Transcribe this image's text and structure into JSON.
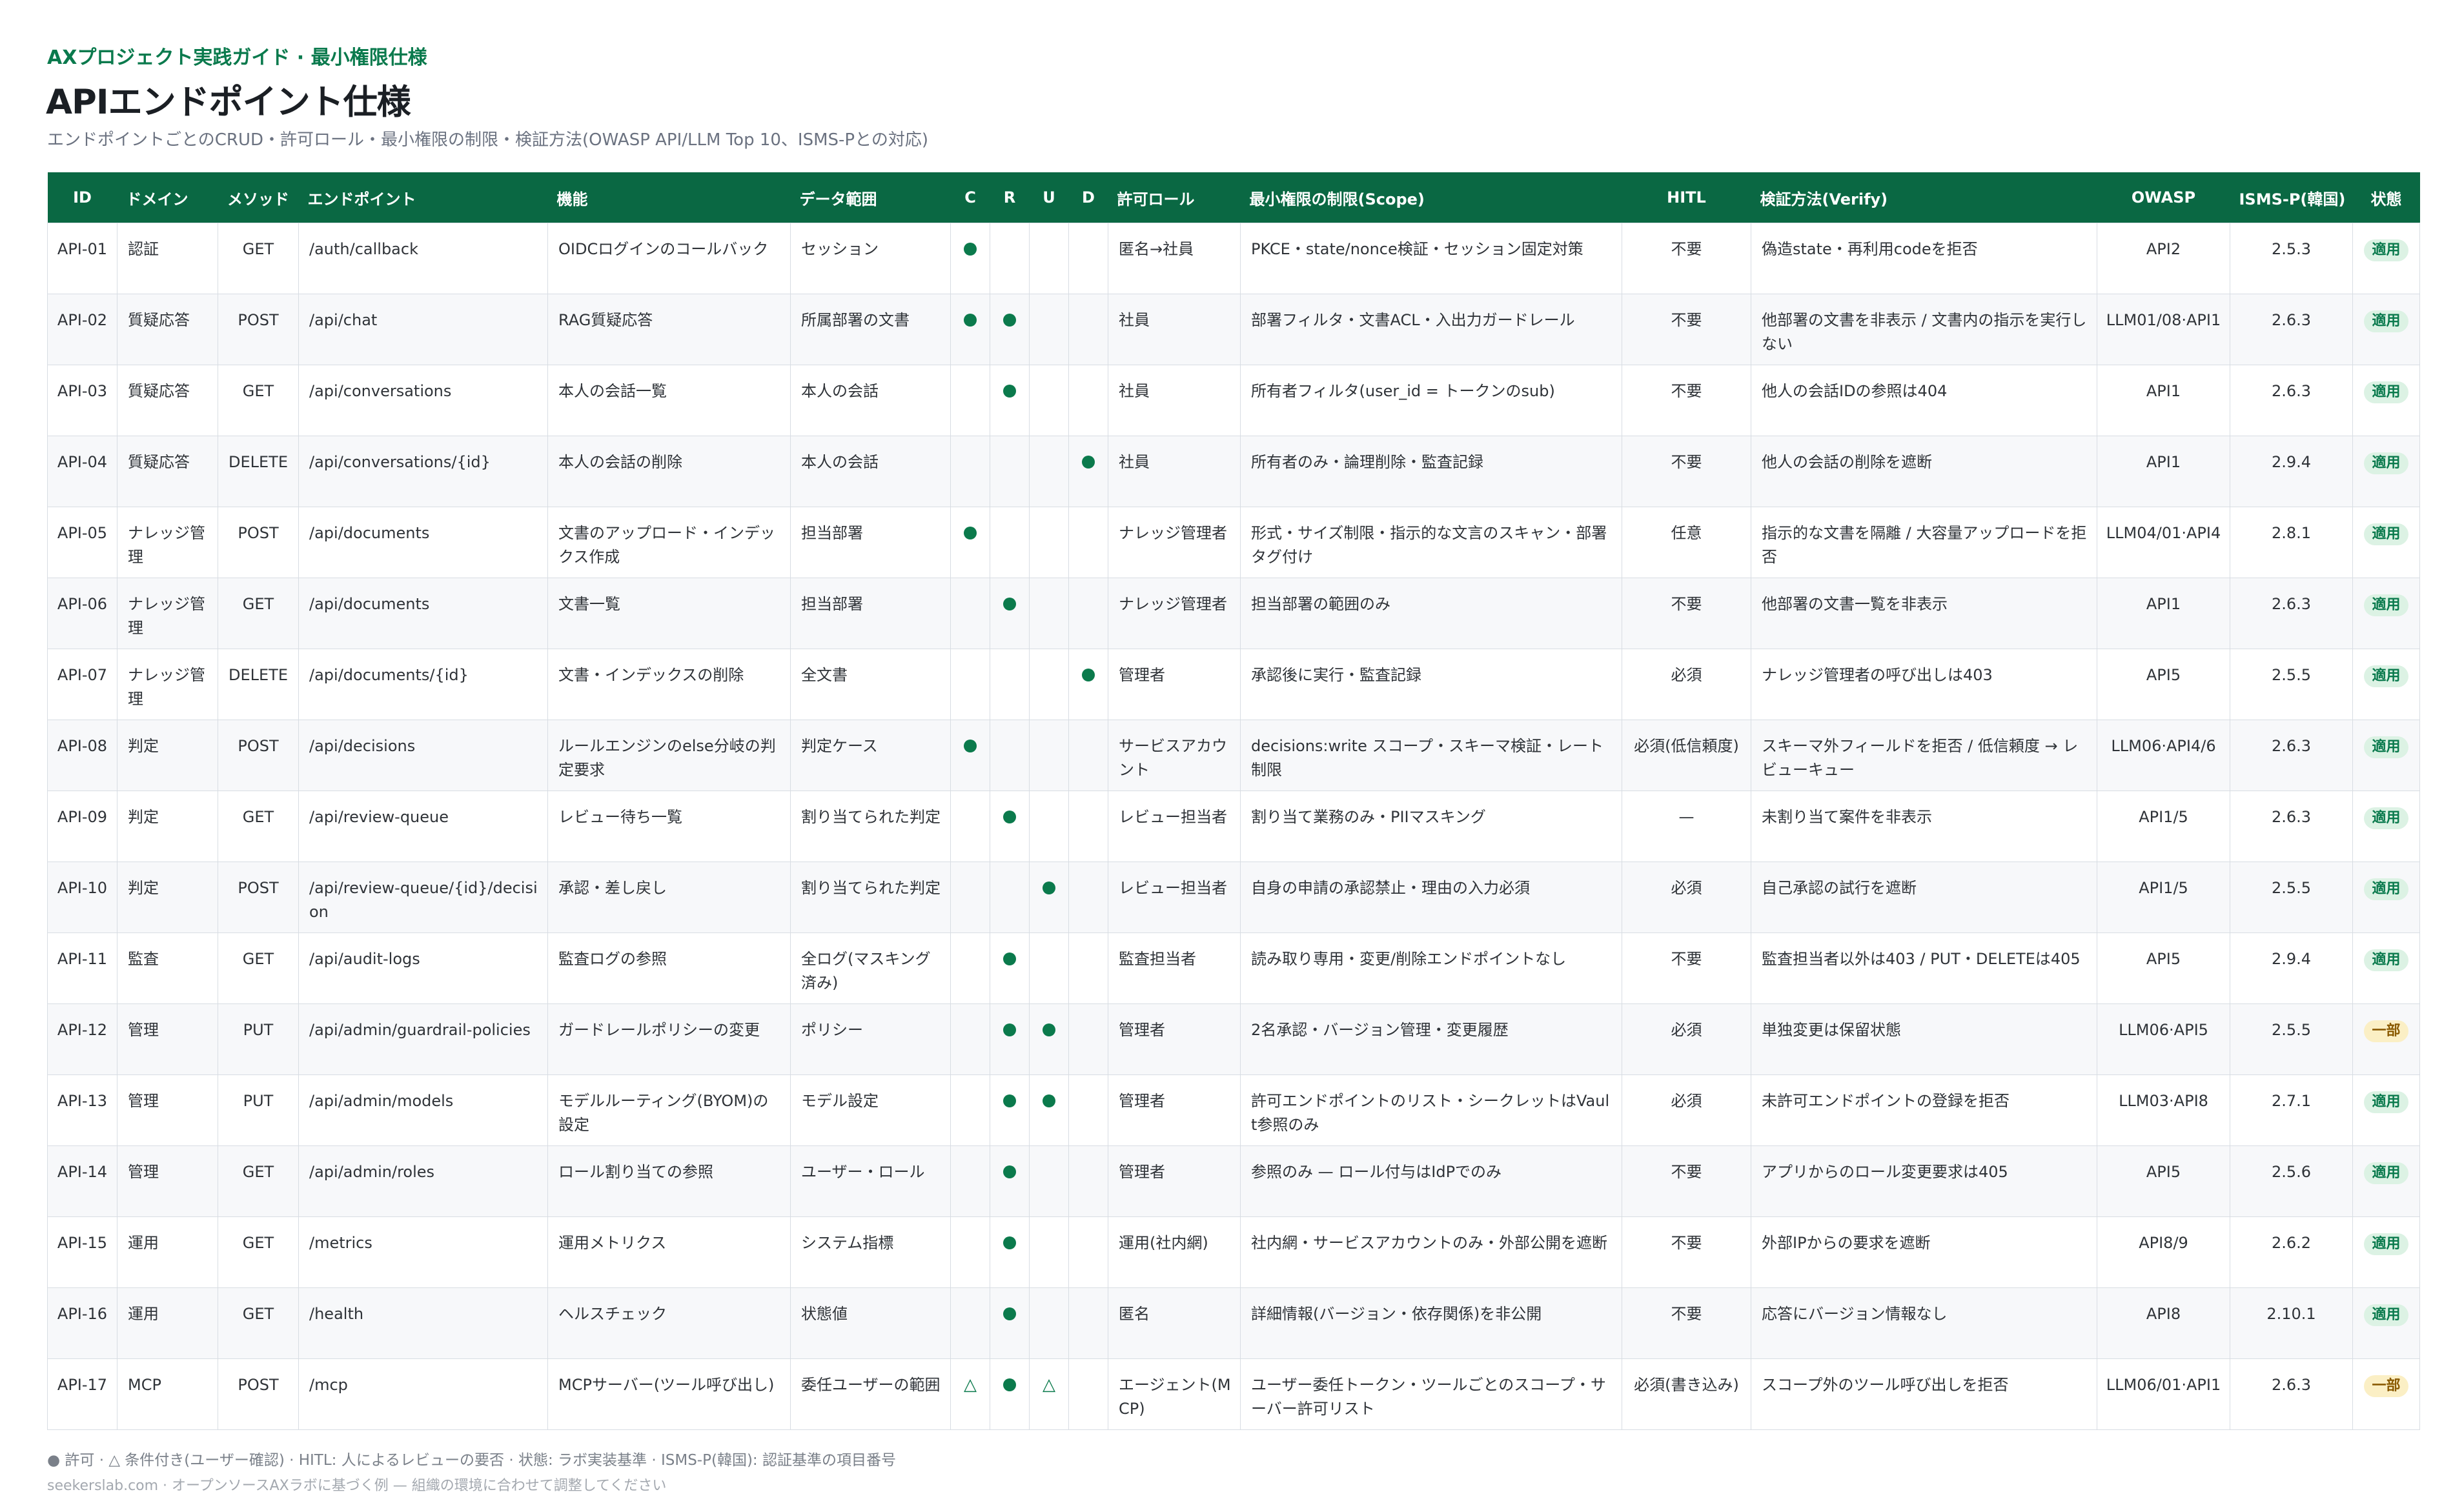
{
  "header": {
    "kicker": "AXプロジェクト実践ガイド · 最小権限仕様",
    "title": "APIエンドポイント仕様",
    "subtitle": "エンドポイントごとのCRUD・許可ロール・最小権限の制限・検証方法(OWASP API/LLM Top 10、ISMS-Pとの対応)"
  },
  "table": {
    "columns": {
      "id": "ID",
      "domain": "ドメイン",
      "method": "メソッド",
      "endpoint": "エンドポイント",
      "function": "機能",
      "data_scope": "データ範囲",
      "c": "C",
      "r": "R",
      "u": "U",
      "d": "D",
      "role": "許可ロール",
      "scope": "最小権限の制限(Scope)",
      "hitl": "HITL",
      "verify": "検証方法(Verify)",
      "owasp": "OWASP",
      "isms": "ISMS-P(韓国)",
      "status": "状態"
    },
    "rows": [
      {
        "id": "API-01",
        "domain": "認証",
        "method": "GET",
        "endpoint": "/auth/callback",
        "function": "OIDCログインのコールバック",
        "data_scope": "セッション",
        "c": "●",
        "r": "",
        "u": "",
        "d": "",
        "role": "匿名→社員",
        "scope": "PKCE・state/nonce検証・セッション固定対策",
        "hitl": "不要",
        "verify": "偽造state・再利用codeを拒否",
        "owasp": "API2",
        "isms": "2.5.3",
        "status": "適用",
        "status_type": "ok"
      },
      {
        "id": "API-02",
        "domain": "質疑応答",
        "method": "POST",
        "endpoint": "/api/chat",
        "function": "RAG質疑応答",
        "data_scope": "所属部署の文書",
        "c": "●",
        "r": "●",
        "u": "",
        "d": "",
        "role": "社員",
        "scope": "部署フィルタ・文書ACL・入出力ガードレール",
        "hitl": "不要",
        "verify": "他部署の文書を非表示 / 文書内の指示を実行しない",
        "owasp": "LLM01/08·API1",
        "isms": "2.6.3",
        "status": "適用",
        "status_type": "ok"
      },
      {
        "id": "API-03",
        "domain": "質疑応答",
        "method": "GET",
        "endpoint": "/api/conversations",
        "function": "本人の会話一覧",
        "data_scope": "本人の会話",
        "c": "",
        "r": "●",
        "u": "",
        "d": "",
        "role": "社員",
        "scope": "所有者フィルタ(user_id = トークンのsub)",
        "hitl": "不要",
        "verify": "他人の会話IDの参照は404",
        "owasp": "API1",
        "isms": "2.6.3",
        "status": "適用",
        "status_type": "ok"
      },
      {
        "id": "API-04",
        "domain": "質疑応答",
        "method": "DELETE",
        "endpoint": "/api/conversations/{id}",
        "function": "本人の会話の削除",
        "data_scope": "本人の会話",
        "c": "",
        "r": "",
        "u": "",
        "d": "●",
        "role": "社員",
        "scope": "所有者のみ・論理削除・監査記録",
        "hitl": "不要",
        "verify": "他人の会話の削除を遮断",
        "owasp": "API1",
        "isms": "2.9.4",
        "status": "適用",
        "status_type": "ok"
      },
      {
        "id": "API-05",
        "domain": "ナレッジ管理",
        "method": "POST",
        "endpoint": "/api/documents",
        "function": "文書のアップロード・インデックス作成",
        "data_scope": "担当部署",
        "c": "●",
        "r": "",
        "u": "",
        "d": "",
        "role": "ナレッジ管理者",
        "scope": "形式・サイズ制限・指示的な文言のスキャン・部署タグ付け",
        "hitl": "任意",
        "verify": "指示的な文書を隔離 / 大容量アップロードを拒否",
        "owasp": "LLM04/01·API4",
        "isms": "2.8.1",
        "status": "適用",
        "status_type": "ok"
      },
      {
        "id": "API-06",
        "domain": "ナレッジ管理",
        "method": "GET",
        "endpoint": "/api/documents",
        "function": "文書一覧",
        "data_scope": "担当部署",
        "c": "",
        "r": "●",
        "u": "",
        "d": "",
        "role": "ナレッジ管理者",
        "scope": "担当部署の範囲のみ",
        "hitl": "不要",
        "verify": "他部署の文書一覧を非表示",
        "owasp": "API1",
        "isms": "2.6.3",
        "status": "適用",
        "status_type": "ok"
      },
      {
        "id": "API-07",
        "domain": "ナレッジ管理",
        "method": "DELETE",
        "endpoint": "/api/documents/{id}",
        "function": "文書・インデックスの削除",
        "data_scope": "全文書",
        "c": "",
        "r": "",
        "u": "",
        "d": "●",
        "role": "管理者",
        "scope": "承認後に実行・監査記録",
        "hitl": "必須",
        "verify": "ナレッジ管理者の呼び出しは403",
        "owasp": "API5",
        "isms": "2.5.5",
        "status": "適用",
        "status_type": "ok"
      },
      {
        "id": "API-08",
        "domain": "判定",
        "method": "POST",
        "endpoint": "/api/decisions",
        "function": "ルールエンジンのelse分岐の判定要求",
        "data_scope": "判定ケース",
        "c": "●",
        "r": "",
        "u": "",
        "d": "",
        "role": "サービスアカウント",
        "scope": "decisions:write スコープ・スキーマ検証・レート制限",
        "hitl": "必須(低信頼度)",
        "verify": "スキーマ外フィールドを拒否 / 低信頼度 → レビューキュー",
        "owasp": "LLM06·API4/6",
        "isms": "2.6.3",
        "status": "適用",
        "status_type": "ok"
      },
      {
        "id": "API-09",
        "domain": "判定",
        "method": "GET",
        "endpoint": "/api/review-queue",
        "function": "レビュー待ち一覧",
        "data_scope": "割り当てられた判定",
        "c": "",
        "r": "●",
        "u": "",
        "d": "",
        "role": "レビュー担当者",
        "scope": "割り当て業務のみ・PIIマスキング",
        "hitl": "—",
        "verify": "未割り当て案件を非表示",
        "owasp": "API1/5",
        "isms": "2.6.3",
        "status": "適用",
        "status_type": "ok"
      },
      {
        "id": "API-10",
        "domain": "判定",
        "method": "POST",
        "endpoint": "/api/review-queue/{id}/decision",
        "function": "承認・差し戻し",
        "data_scope": "割り当てられた判定",
        "c": "",
        "r": "",
        "u": "●",
        "d": "",
        "role": "レビュー担当者",
        "scope": "自身の申請の承認禁止・理由の入力必須",
        "hitl": "必須",
        "verify": "自己承認の試行を遮断",
        "owasp": "API1/5",
        "isms": "2.5.5",
        "status": "適用",
        "status_type": "ok"
      },
      {
        "id": "API-11",
        "domain": "監査",
        "method": "GET",
        "endpoint": "/api/audit-logs",
        "function": "監査ログの参照",
        "data_scope": "全ログ(マスキング済み)",
        "c": "",
        "r": "●",
        "u": "",
        "d": "",
        "role": "監査担当者",
        "scope": "読み取り専用・変更/削除エンドポイントなし",
        "hitl": "不要",
        "verify": "監査担当者以外は403 / PUT・DELETEは405",
        "owasp": "API5",
        "isms": "2.9.4",
        "status": "適用",
        "status_type": "ok"
      },
      {
        "id": "API-12",
        "domain": "管理",
        "method": "PUT",
        "endpoint": "/api/admin/guardrail-policies",
        "function": "ガードレールポリシーの変更",
        "data_scope": "ポリシー",
        "c": "",
        "r": "●",
        "u": "●",
        "d": "",
        "role": "管理者",
        "scope": "2名承認・バージョン管理・変更履歴",
        "hitl": "必須",
        "verify": "単独変更は保留状態",
        "owasp": "LLM06·API5",
        "isms": "2.5.5",
        "status": "一部",
        "status_type": "part"
      },
      {
        "id": "API-13",
        "domain": "管理",
        "method": "PUT",
        "endpoint": "/api/admin/models",
        "function": "モデルルーティング(BYOM)の設定",
        "data_scope": "モデル設定",
        "c": "",
        "r": "●",
        "u": "●",
        "d": "",
        "role": "管理者",
        "scope": "許可エンドポイントのリスト・シークレットはVault参照のみ",
        "hitl": "必須",
        "verify": "未許可エンドポイントの登録を拒否",
        "owasp": "LLM03·API8",
        "isms": "2.7.1",
        "status": "適用",
        "status_type": "ok"
      },
      {
        "id": "API-14",
        "domain": "管理",
        "method": "GET",
        "endpoint": "/api/admin/roles",
        "function": "ロール割り当ての参照",
        "data_scope": "ユーザー・ロール",
        "c": "",
        "r": "●",
        "u": "",
        "d": "",
        "role": "管理者",
        "scope": "参照のみ — ロール付与はIdPでのみ",
        "hitl": "不要",
        "verify": "アプリからのロール変更要求は405",
        "owasp": "API5",
        "isms": "2.5.6",
        "status": "適用",
        "status_type": "ok"
      },
      {
        "id": "API-15",
        "domain": "運用",
        "method": "GET",
        "endpoint": "/metrics",
        "function": "運用メトリクス",
        "data_scope": "システム指標",
        "c": "",
        "r": "●",
        "u": "",
        "d": "",
        "role": "運用(社内網)",
        "scope": "社内網・サービスアカウントのみ・外部公開を遮断",
        "hitl": "不要",
        "verify": "外部IPからの要求を遮断",
        "owasp": "API8/9",
        "isms": "2.6.2",
        "status": "適用",
        "status_type": "ok"
      },
      {
        "id": "API-16",
        "domain": "運用",
        "method": "GET",
        "endpoint": "/health",
        "function": "ヘルスチェック",
        "data_scope": "状態値",
        "c": "",
        "r": "●",
        "u": "",
        "d": "",
        "role": "匿名",
        "scope": "詳細情報(バージョン・依存関係)を非公開",
        "hitl": "不要",
        "verify": "応答にバージョン情報なし",
        "owasp": "API8",
        "isms": "2.10.1",
        "status": "適用",
        "status_type": "ok"
      },
      {
        "id": "API-17",
        "domain": "MCP",
        "method": "POST",
        "endpoint": "/mcp",
        "function": "MCPサーバー(ツール呼び出し)",
        "data_scope": "委任ユーザーの範囲",
        "c": "△",
        "r": "●",
        "u": "△",
        "d": "",
        "role": "エージェント(MCP)",
        "scope": "ユーザー委任トークン・ツールごとのスコープ・サーバー許可リスト",
        "hitl": "必須(書き込み)",
        "verify": "スコープ外のツール呼び出しを拒否",
        "owasp": "LLM06/01·API1",
        "isms": "2.6.3",
        "status": "一部",
        "status_type": "part"
      }
    ]
  },
  "footer": {
    "legend": "● 許可 · △ 条件付き(ユーザー確認) · HITL: 人によるレビューの要否 · 状態: ラボ実装基準 · ISMS-P(韓国): 認証基準の項目番号",
    "credit": "seekerslab.com · オープンソースAXラボに基づく例 — 組織の環境に合わせて調整してください"
  }
}
